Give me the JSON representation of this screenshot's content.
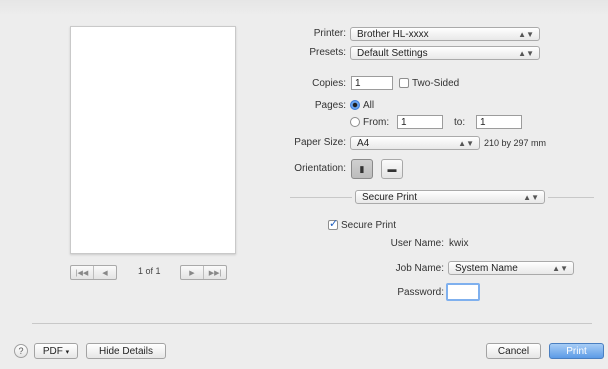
{
  "preview": {
    "page_indicator": "1 of 1",
    "nav_first": "|◀◀",
    "nav_prev": "◀",
    "nav_next": "▶",
    "nav_last": "▶▶|"
  },
  "printer": {
    "label": "Printer:",
    "value": "Brother HL-xxxx"
  },
  "presets": {
    "label": "Presets:",
    "value": "Default Settings"
  },
  "copies": {
    "label": "Copies:",
    "value": "1",
    "two_sided_label": "Two-Sided",
    "two_sided_checked": false
  },
  "pages": {
    "label": "Pages:",
    "all_label": "All",
    "from_label": "From:",
    "from_value": "1",
    "to_label": "to:",
    "to_value": "1",
    "selected": "All"
  },
  "paper_size": {
    "label": "Paper Size:",
    "value": "A4",
    "dimensions": "210 by 297 mm"
  },
  "orientation": {
    "label": "Orientation:",
    "selected": "portrait"
  },
  "section": {
    "value": "Secure Print"
  },
  "secure_print": {
    "checkbox_label": "Secure Print",
    "checked": true,
    "user_name_label": "User Name:",
    "user_name_value": "kwix",
    "job_name_label": "Job Name:",
    "job_name_value": "System Name",
    "password_label": "Password:"
  },
  "footer": {
    "help": "?",
    "pdf_label": "PDF",
    "hide_details_label": "Hide Details",
    "cancel_label": "Cancel",
    "print_label": "Print"
  },
  "colors": {
    "accent": "#5c9be6",
    "background": "#ededed"
  }
}
